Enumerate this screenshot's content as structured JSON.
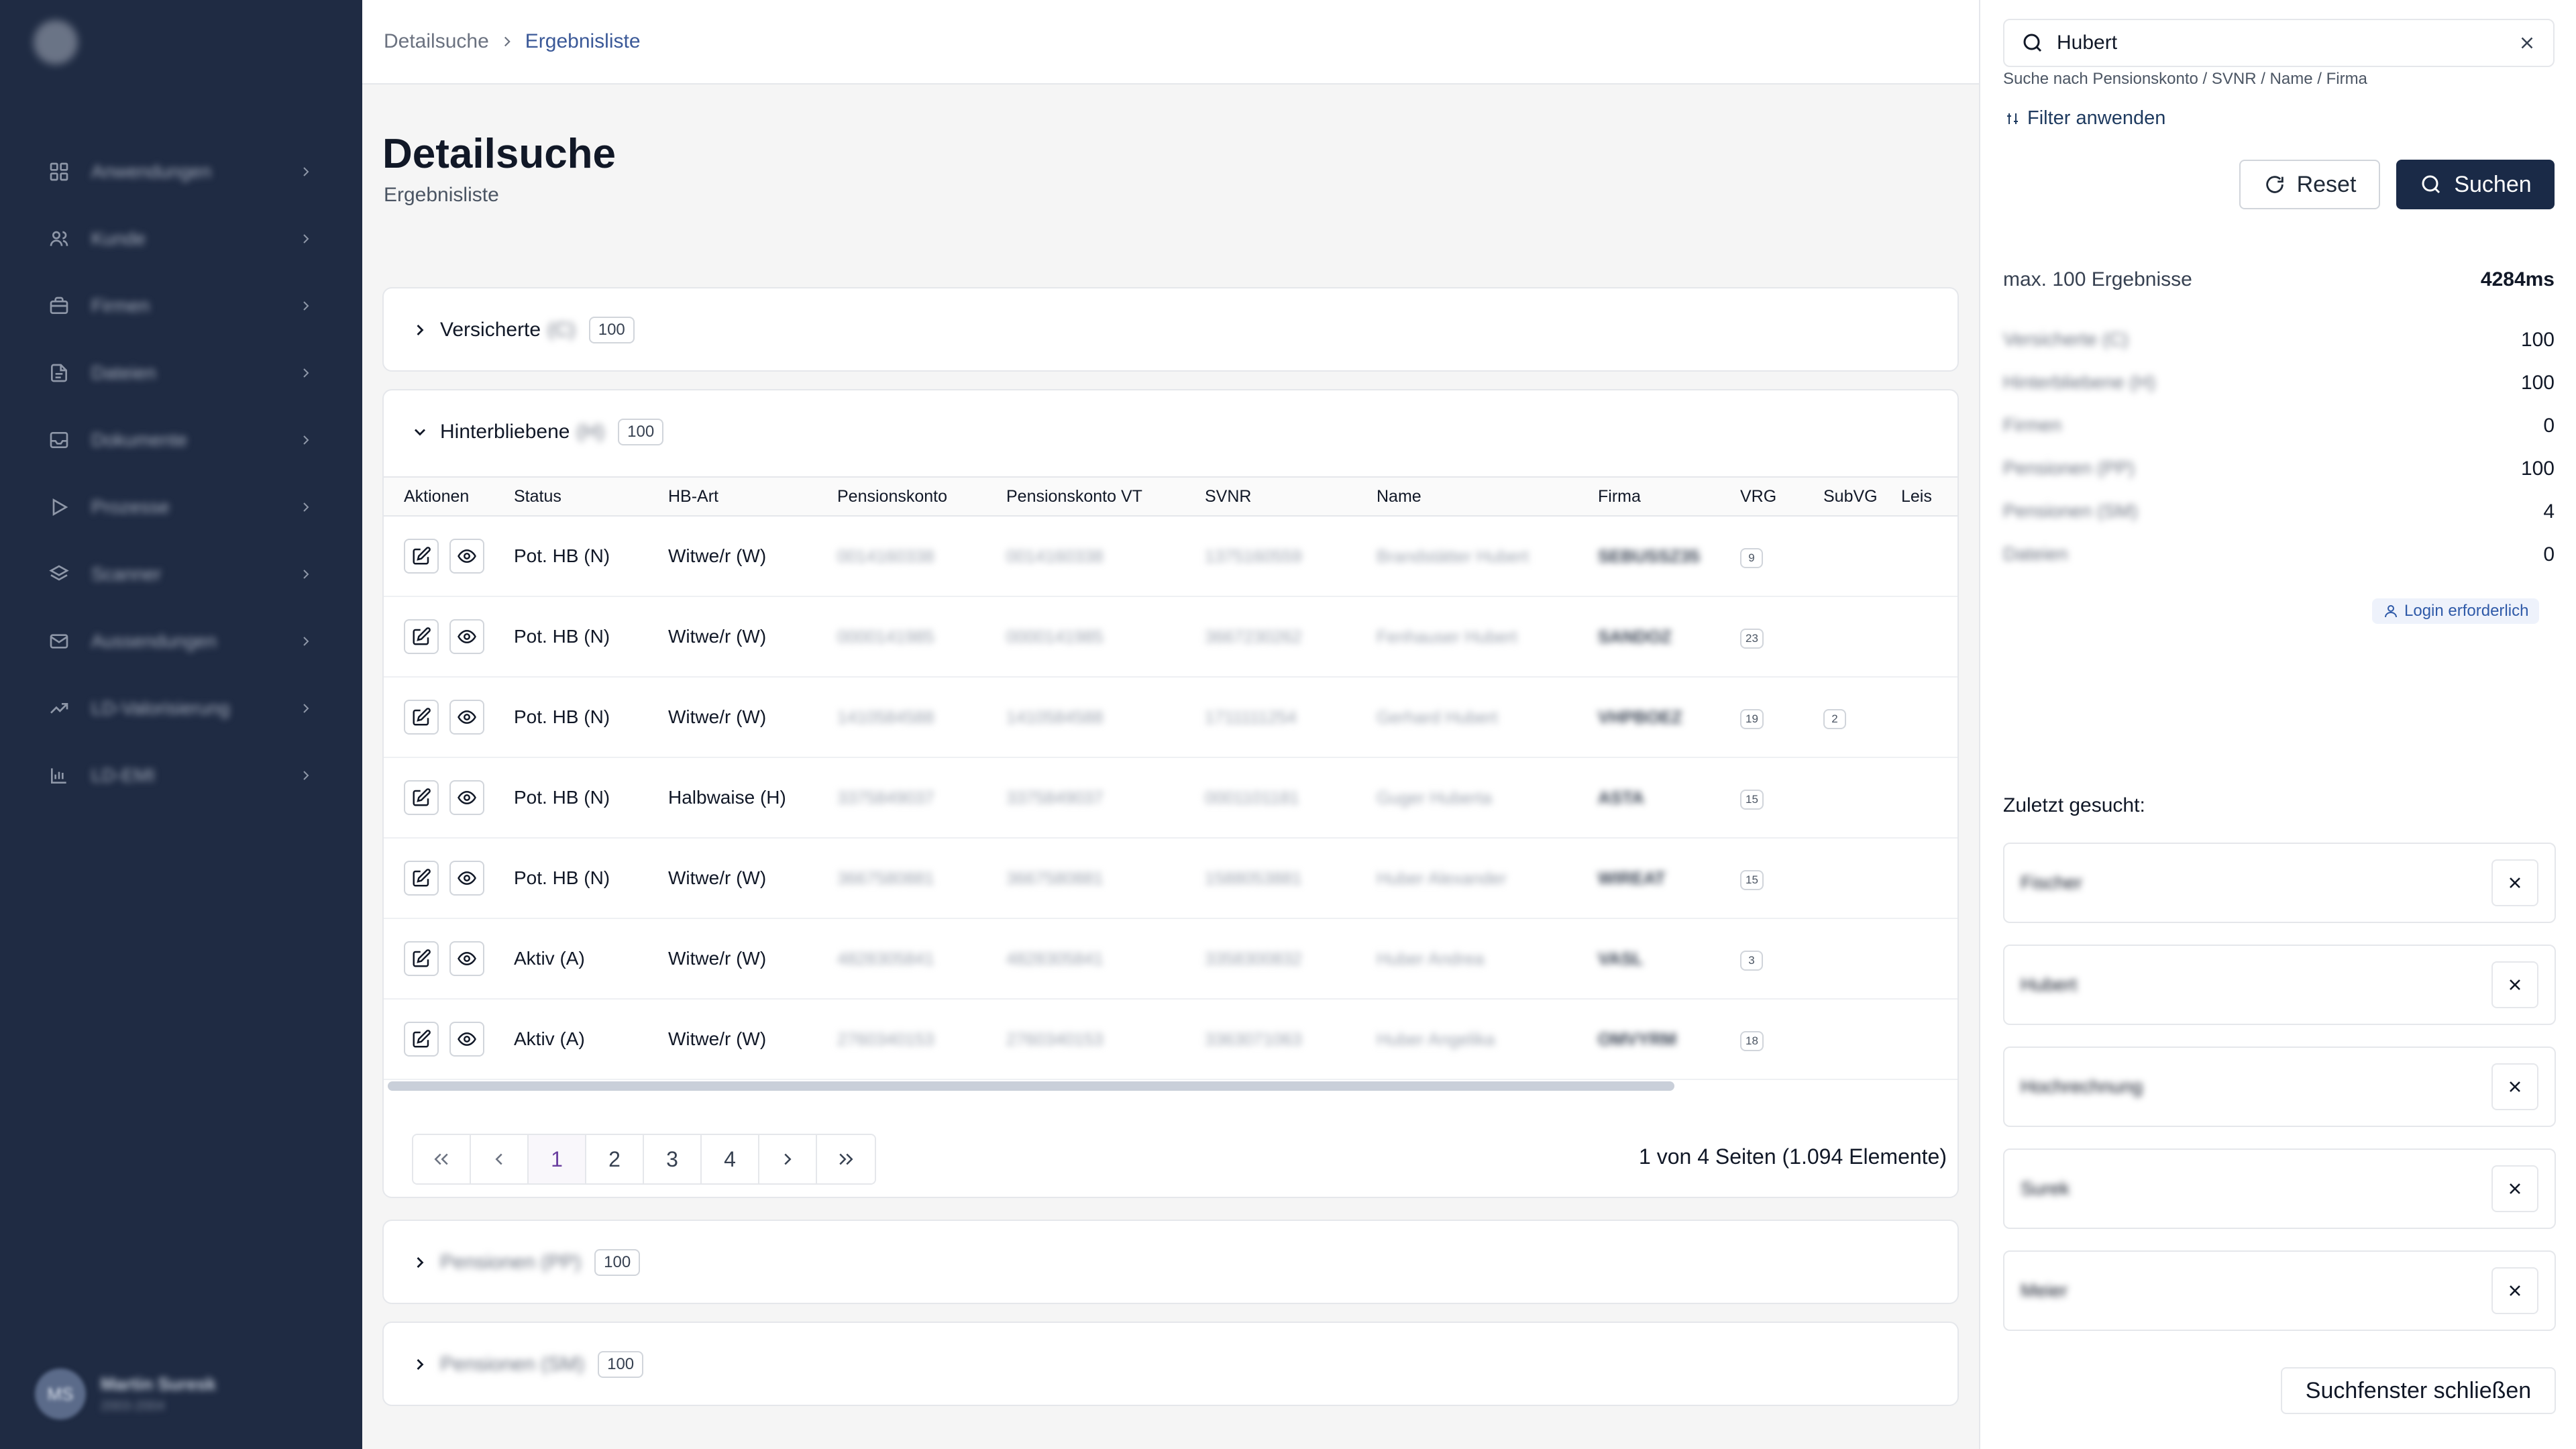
{
  "sidebar": {
    "items": [
      {
        "label": "Anwendungen",
        "icon": "grid-icon"
      },
      {
        "label": "Kunde",
        "icon": "users-icon"
      },
      {
        "label": "Firmen",
        "icon": "briefcase-icon"
      },
      {
        "label": "Dateien",
        "icon": "file-icon"
      },
      {
        "label": "Dokumente",
        "icon": "inbox-icon"
      },
      {
        "label": "Prozesse",
        "icon": "play-icon"
      },
      {
        "label": "Scanner",
        "icon": "layers-icon"
      },
      {
        "label": "Aussendungen",
        "icon": "mail-icon"
      },
      {
        "label": "LD-Valorisierung",
        "icon": "trending-icon"
      },
      {
        "label": "LD-EMI",
        "icon": "bar-chart-icon"
      }
    ],
    "user": {
      "initials": "MS",
      "name": "Martin Suresk",
      "sub": "2003-2004"
    }
  },
  "breadcrumb": {
    "parent": "Detailsuche",
    "current": "Ergebnisliste"
  },
  "page": {
    "title": "Detailsuche",
    "subtitle": "Ergebnisliste"
  },
  "sections": {
    "versicherte": {
      "label": "Versicherte",
      "suffix": "(C)",
      "count": "100"
    },
    "hinterbliebene": {
      "label": "Hinterbliebene",
      "suffix": "(H)",
      "count": "100"
    },
    "third": {
      "label": "Pensionen (PP)",
      "count": "100"
    },
    "fourth": {
      "label": "Pensionen (SM)",
      "count": "100"
    }
  },
  "table": {
    "columns": {
      "aktionen": "Aktionen",
      "status": "Status",
      "hbart": "HB-Art",
      "pk": "Pensionskonto",
      "pkvt": "Pensionskonto VT",
      "svnr": "SVNR",
      "name": "Name",
      "firma": "Firma",
      "vrg": "VRG",
      "subvg": "SubVG",
      "leis": "Leis"
    },
    "rows": [
      {
        "status": "Pot. HB (N)",
        "hbart": "Witwe/r (W)",
        "pk": "0014160338",
        "pkvt": "0014160338",
        "svnr": "1375160559",
        "name": "Brandstätter Hubert",
        "firma": "SEBUSSZ35",
        "vrg": "9",
        "subvg": ""
      },
      {
        "status": "Pot. HB (N)",
        "hbart": "Witwe/r (W)",
        "pk": "0000141985",
        "pkvt": "0000141985",
        "svnr": "3667230262",
        "name": "Fenhauser Hubert",
        "firma": "SANDOZ",
        "vrg": "23",
        "subvg": ""
      },
      {
        "status": "Pot. HB (N)",
        "hbart": "Witwe/r (W)",
        "pk": "1410584588",
        "pkvt": "1410584588",
        "svnr": "1711111254",
        "name": "Gerhard Hubert",
        "firma": "VHPBOEZ",
        "vrg": "19",
        "subvg": "2"
      },
      {
        "status": "Pot. HB (N)",
        "hbart": "Halbwaise (H)",
        "pk": "3375849037",
        "pkvt": "3375849037",
        "svnr": "0001101181",
        "name": "Guger Huberta",
        "firma": "ASTA",
        "vrg": "15",
        "subvg": ""
      },
      {
        "status": "Pot. HB (N)",
        "hbart": "Witwe/r (W)",
        "pk": "3667580881",
        "pkvt": "3667580881",
        "svnr": "1588053881",
        "name": "Huber Alexander",
        "firma": "WIREAT",
        "vrg": "15",
        "subvg": ""
      },
      {
        "status": "Aktiv (A)",
        "hbart": "Witwe/r (W)",
        "pk": "4828305841",
        "pkvt": "4828305841",
        "svnr": "3358300832",
        "name": "Huber Andrea",
        "firma": "VASL",
        "vrg": "3",
        "subvg": ""
      },
      {
        "status": "Aktiv (A)",
        "hbart": "Witwe/r (W)",
        "pk": "2760340153",
        "pkvt": "2760340153",
        "svnr": "3363071063",
        "name": "Huber Angelika",
        "firma": "OMVYRM",
        "vrg": "18",
        "subvg": ""
      }
    ]
  },
  "pagination": {
    "pages": [
      "1",
      "2",
      "3",
      "4"
    ],
    "active": "1",
    "info": "1 von 4 Seiten (1.094 Elemente)"
  },
  "panel": {
    "search_value": "Hubert",
    "search_hint": "Suche nach Pensionskonto / SVNR / Name / Firma",
    "filter_label": "Filter anwenden",
    "reset_label": "Reset",
    "search_label": "Suchen",
    "max_label": "max. 100 Ergebnisse",
    "time": "4284ms",
    "stats": [
      {
        "label": "Versicherte (C)",
        "value": "100"
      },
      {
        "label": "Hinterbliebene (H)",
        "value": "100"
      },
      {
        "label": "Firmen",
        "value": "0"
      },
      {
        "label": "Pensionen (PP)",
        "value": "100"
      },
      {
        "label": "Pensionen (SM)",
        "value": "4"
      },
      {
        "label": "Dateien",
        "value": "0"
      }
    ],
    "login_label": "Login erforderlich",
    "recent_title": "Zuletzt gesucht:",
    "recent": [
      "Fischer",
      "Hubert",
      "Hochrechnung",
      "Surek",
      "Meier"
    ],
    "close_label": "Suchfenster schließen"
  }
}
